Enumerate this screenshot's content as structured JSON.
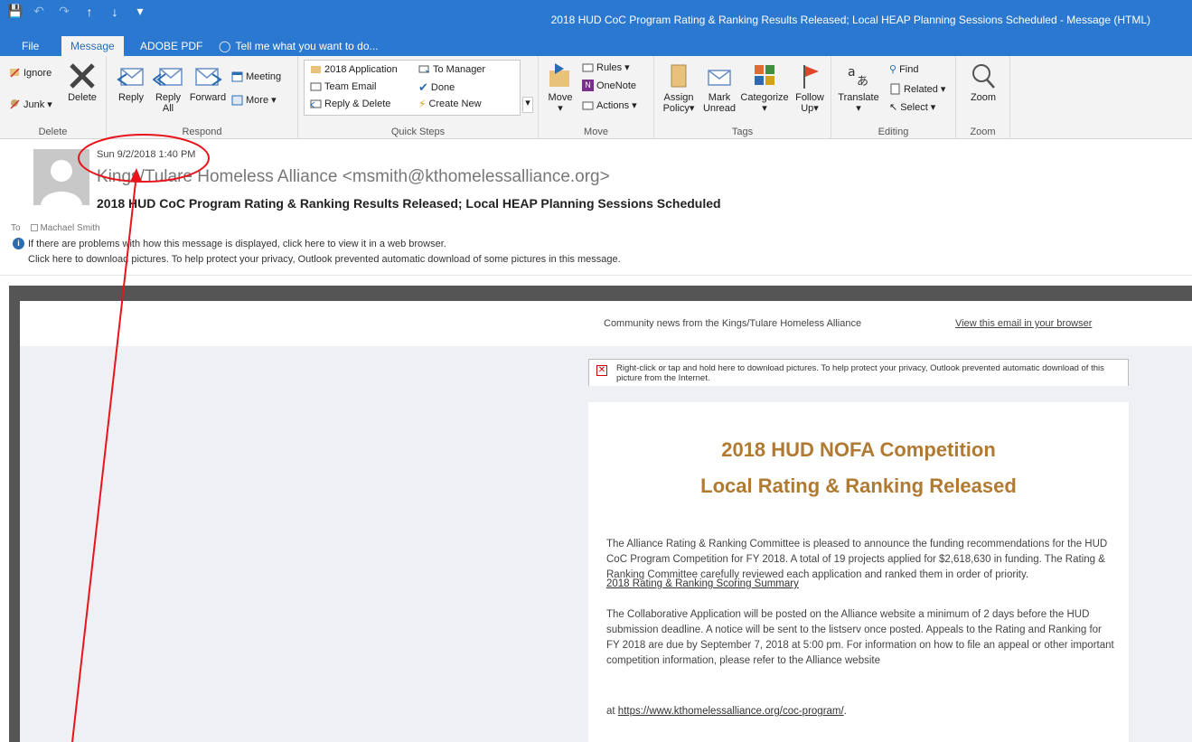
{
  "window": {
    "title": "2018 HUD CoC Program Rating & Ranking Results Released; Local HEAP Planning Sessions Scheduled - Message (HTML)"
  },
  "tabs": [
    "File",
    "Message",
    "ADOBE PDF",
    "Tell me what you want to do..."
  ],
  "ribbon": {
    "delete_group": {
      "label": "Delete",
      "ignore": "Ignore",
      "junk": "Junk",
      "delete": "Delete"
    },
    "respond_group": {
      "label": "Respond",
      "reply": "Reply",
      "reply_all_1": "Reply",
      "reply_all_2": "All",
      "forward": "Forward",
      "meeting": "Meeting",
      "more": "More"
    },
    "quick_steps": {
      "label": "Quick Steps",
      "items": [
        "2018 Application",
        "To Manager",
        "Team Email",
        "Done",
        "Reply & Delete",
        "Create New"
      ]
    },
    "move_group": {
      "label": "Move",
      "move": "Move",
      "rules": "Rules",
      "onenote": "OneNote",
      "actions": "Actions"
    },
    "tags_group": {
      "label": "Tags",
      "assign_1": "Assign",
      "assign_2": "Policy",
      "mark_1": "Mark",
      "mark_2": "Unread",
      "categorize": "Categorize",
      "follow_1": "Follow",
      "follow_2": "Up"
    },
    "editing_group": {
      "label": "Editing",
      "translate": "Translate",
      "find": "Find",
      "related": "Related",
      "select": "Select"
    },
    "zoom_group": {
      "label": "Zoom",
      "zoom": "Zoom"
    }
  },
  "message": {
    "date": "Sun 9/2/2018 1:40 PM",
    "from": "Kings/Tulare Homeless Alliance <msmith@kthomelessalliance.org>",
    "subject": "2018 HUD CoC Program Rating & Ranking Results Released; Local HEAP Planning Sessions Scheduled",
    "to_label": "To",
    "to_name": "Machael Smith",
    "info_browser": "If there are problems with how this message is displayed, click here to view it in a web browser.",
    "info_pictures": "Click here to download pictures. To help protect your privacy, Outlook prevented automatic download of some pictures in this message."
  },
  "email_body": {
    "community_news": "Community news from the Kings/Tulare Homeless Alliance",
    "view_browser": "View this email in your browser",
    "image_blocked": "Right-click or tap and hold here to download pictures. To help protect your privacy, Outlook prevented automatic download of this picture from the Internet.",
    "heading_1": "2018 HUD NOFA Competition",
    "heading_2": "Local Rating & Ranking Released",
    "para_1": "The Alliance Rating & Ranking Committee is pleased to announce the funding recommendations for the HUD CoC Program Competition for FY 2018.  A total of 19 projects applied for $2,618,630 in funding.  The Rating & Ranking Committee carefully reviewed each application and ranked them in order of priority.",
    "summary_link": "2018 Rating & Ranking Scoring Summary",
    "para_2": "The Collaborative Application will be posted on the Alliance website a minimum of 2 days before the HUD submission deadline.  A notice will be sent to the listserv once posted.  Appeals to the Rating and Ranking for FY 2018 are due by September 7, 2018 at 5:00 pm.  For information on how to file an appeal or other important competition information, please refer to the Alliance website",
    "at_prefix": "at",
    "website_link": "https://www.kthomelessalliance.org/coc-program/",
    "website_suffix": "."
  },
  "annotation_color": "#e8141c",
  "accent_color": "#2b78d0",
  "heading_color": "#b07a32"
}
